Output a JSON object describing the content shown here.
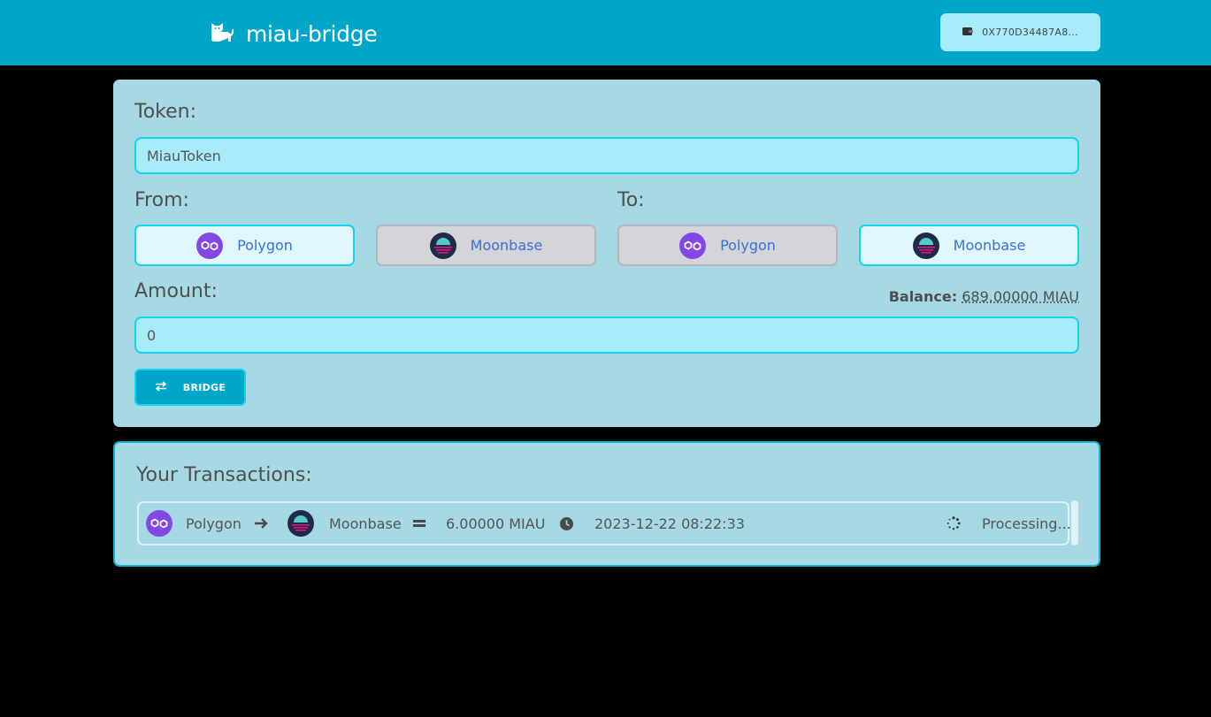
{
  "header": {
    "app_title": "miau-bridge",
    "logo_icon": "cat-icon",
    "wallet_icon": "wallet-icon",
    "wallet_address": "0X770D34487A8..."
  },
  "bridge_form": {
    "token_label": "Token:",
    "token_value": "MiauToken",
    "from_label": "From:",
    "to_label": "To:",
    "from_options": [
      {
        "name": "Polygon",
        "icon": "polygon-icon",
        "selected": true
      },
      {
        "name": "Moonbase",
        "icon": "moonbase-icon",
        "selected": false
      }
    ],
    "to_options": [
      {
        "name": "Polygon",
        "icon": "polygon-icon",
        "selected": false
      },
      {
        "name": "Moonbase",
        "icon": "moonbase-icon",
        "selected": true
      }
    ],
    "amount_label": "Amount:",
    "balance_label": "Balance:",
    "balance_value": "689.00000 MIAU",
    "amount_value": "0",
    "bridge_button": "BRIDGE",
    "bridge_icon": "swap-arrows-icon"
  },
  "transactions": {
    "title": "Your Transactions:",
    "items": [
      {
        "from_chain": "Polygon",
        "to_chain": "Moonbase",
        "amount": "6.00000 MIAU",
        "timestamp": "2023-12-22 08:22:33",
        "status": "Processing..."
      }
    ]
  },
  "colors": {
    "header_bg": "#00a6c9",
    "card_bg": "#a6d9e3",
    "input_bg": "#a8ecfb",
    "accent_border": "#12d4ee",
    "selected_btn_bg": "#e0f8fd",
    "unselected_btn_bg": "#d3d5d8",
    "polygon_purple": "#8247e5",
    "link_blue": "#3a6fd8"
  }
}
